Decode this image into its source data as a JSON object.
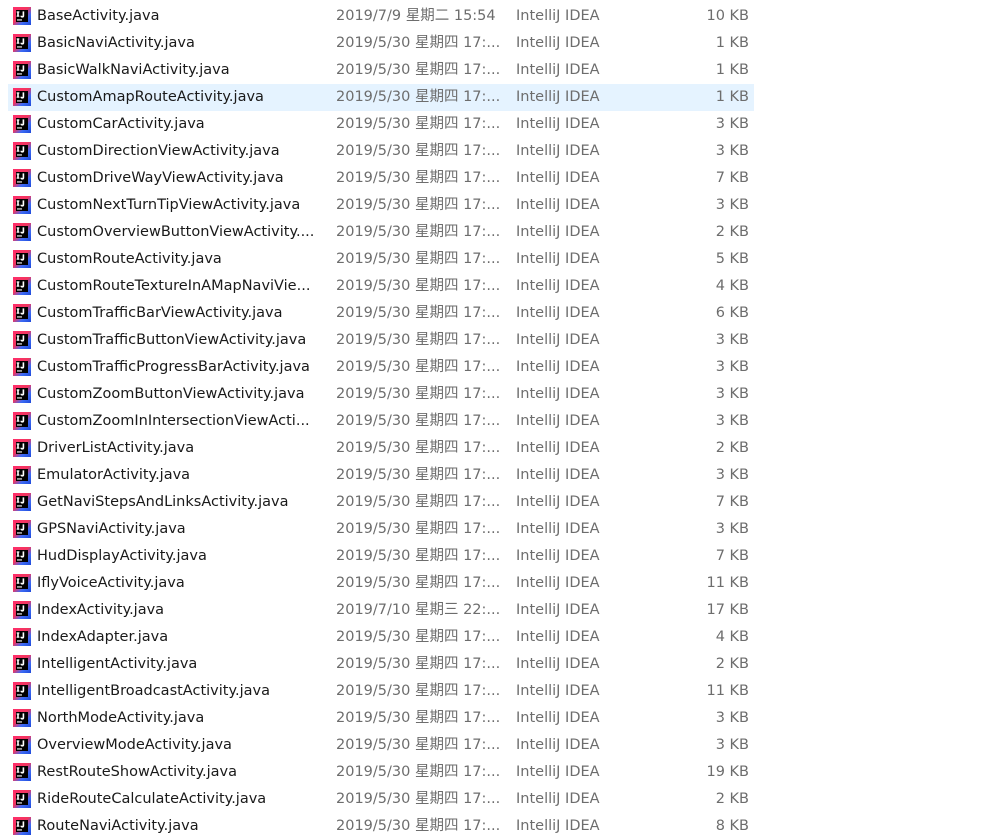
{
  "files": [
    {
      "name": "BaseActivity.java",
      "date": "2019/7/9 星期二 15:54",
      "type": "IntelliJ IDEA",
      "size": "10 KB",
      "icon": "intellij-idea-icon"
    },
    {
      "name": "BasicNaviActivity.java",
      "date": "2019/5/30 星期四 17:...",
      "type": "IntelliJ IDEA",
      "size": "1 KB",
      "icon": "intellij-idea-icon"
    },
    {
      "name": "BasicWalkNaviActivity.java",
      "date": "2019/5/30 星期四 17:...",
      "type": "IntelliJ IDEA",
      "size": "1 KB",
      "icon": "intellij-idea-icon"
    },
    {
      "name": "CustomAmapRouteActivity.java",
      "date": "2019/5/30 星期四 17:...",
      "type": "IntelliJ IDEA",
      "size": "1 KB",
      "icon": "intellij-idea-icon",
      "selected": true
    },
    {
      "name": "CustomCarActivity.java",
      "date": "2019/5/30 星期四 17:...",
      "type": "IntelliJ IDEA",
      "size": "3 KB",
      "icon": "intellij-idea-icon"
    },
    {
      "name": "CustomDirectionViewActivity.java",
      "date": "2019/5/30 星期四 17:...",
      "type": "IntelliJ IDEA",
      "size": "3 KB",
      "icon": "intellij-idea-icon"
    },
    {
      "name": "CustomDriveWayViewActivity.java",
      "date": "2019/5/30 星期四 17:...",
      "type": "IntelliJ IDEA",
      "size": "7 KB",
      "icon": "intellij-idea-icon"
    },
    {
      "name": "CustomNextTurnTipViewActivity.java",
      "date": "2019/5/30 星期四 17:...",
      "type": "IntelliJ IDEA",
      "size": "3 KB",
      "icon": "intellij-idea-icon"
    },
    {
      "name": "CustomOverviewButtonViewActivity....",
      "date": "2019/5/30 星期四 17:...",
      "type": "IntelliJ IDEA",
      "size": "2 KB",
      "icon": "intellij-idea-icon"
    },
    {
      "name": "CustomRouteActivity.java",
      "date": "2019/5/30 星期四 17:...",
      "type": "IntelliJ IDEA",
      "size": "5 KB",
      "icon": "intellij-idea-icon"
    },
    {
      "name": "CustomRouteTextureInAMapNaviVie...",
      "date": "2019/5/30 星期四 17:...",
      "type": "IntelliJ IDEA",
      "size": "4 KB",
      "icon": "intellij-idea-icon"
    },
    {
      "name": "CustomTrafficBarViewActivity.java",
      "date": "2019/5/30 星期四 17:...",
      "type": "IntelliJ IDEA",
      "size": "6 KB",
      "icon": "intellij-idea-icon"
    },
    {
      "name": "CustomTrafficButtonViewActivity.java",
      "date": "2019/5/30 星期四 17:...",
      "type": "IntelliJ IDEA",
      "size": "3 KB",
      "icon": "intellij-idea-icon"
    },
    {
      "name": "CustomTrafficProgressBarActivity.java",
      "date": "2019/5/30 星期四 17:...",
      "type": "IntelliJ IDEA",
      "size": "3 KB",
      "icon": "intellij-idea-icon"
    },
    {
      "name": "CustomZoomButtonViewActivity.java",
      "date": "2019/5/30 星期四 17:...",
      "type": "IntelliJ IDEA",
      "size": "3 KB",
      "icon": "intellij-idea-icon"
    },
    {
      "name": "CustomZoomInIntersectionViewActi...",
      "date": "2019/5/30 星期四 17:...",
      "type": "IntelliJ IDEA",
      "size": "3 KB",
      "icon": "intellij-idea-icon"
    },
    {
      "name": "DriverListActivity.java",
      "date": "2019/5/30 星期四 17:...",
      "type": "IntelliJ IDEA",
      "size": "2 KB",
      "icon": "intellij-idea-icon"
    },
    {
      "name": "EmulatorActivity.java",
      "date": "2019/5/30 星期四 17:...",
      "type": "IntelliJ IDEA",
      "size": "3 KB",
      "icon": "intellij-idea-icon"
    },
    {
      "name": "GetNaviStepsAndLinksActivity.java",
      "date": "2019/5/30 星期四 17:...",
      "type": "IntelliJ IDEA",
      "size": "7 KB",
      "icon": "intellij-idea-icon"
    },
    {
      "name": "GPSNaviActivity.java",
      "date": "2019/5/30 星期四 17:...",
      "type": "IntelliJ IDEA",
      "size": "3 KB",
      "icon": "intellij-idea-icon"
    },
    {
      "name": "HudDisplayActivity.java",
      "date": "2019/5/30 星期四 17:...",
      "type": "IntelliJ IDEA",
      "size": "7 KB",
      "icon": "intellij-idea-icon"
    },
    {
      "name": "IflyVoiceActivity.java",
      "date": "2019/5/30 星期四 17:...",
      "type": "IntelliJ IDEA",
      "size": "11 KB",
      "icon": "intellij-idea-icon"
    },
    {
      "name": "IndexActivity.java",
      "date": "2019/7/10 星期三 22:...",
      "type": "IntelliJ IDEA",
      "size": "17 KB",
      "icon": "intellij-idea-icon"
    },
    {
      "name": "IndexAdapter.java",
      "date": "2019/5/30 星期四 17:...",
      "type": "IntelliJ IDEA",
      "size": "4 KB",
      "icon": "intellij-idea-icon"
    },
    {
      "name": "IntelligentActivity.java",
      "date": "2019/5/30 星期四 17:...",
      "type": "IntelliJ IDEA",
      "size": "2 KB",
      "icon": "intellij-idea-icon"
    },
    {
      "name": "IntelligentBroadcastActivity.java",
      "date": "2019/5/30 星期四 17:...",
      "type": "IntelliJ IDEA",
      "size": "11 KB",
      "icon": "intellij-idea-icon"
    },
    {
      "name": "NorthModeActivity.java",
      "date": "2019/5/30 星期四 17:...",
      "type": "IntelliJ IDEA",
      "size": "3 KB",
      "icon": "intellij-idea-icon"
    },
    {
      "name": "OverviewModeActivity.java",
      "date": "2019/5/30 星期四 17:...",
      "type": "IntelliJ IDEA",
      "size": "3 KB",
      "icon": "intellij-idea-icon"
    },
    {
      "name": "RestRouteShowActivity.java",
      "date": "2019/5/30 星期四 17:...",
      "type": "IntelliJ IDEA",
      "size": "19 KB",
      "icon": "intellij-idea-icon"
    },
    {
      "name": "RideRouteCalculateActivity.java",
      "date": "2019/5/30 星期四 17:...",
      "type": "IntelliJ IDEA",
      "size": "2 KB",
      "icon": "intellij-idea-icon"
    },
    {
      "name": "RouteNaviActivity.java",
      "date": "2019/5/30 星期四 17:...",
      "type": "IntelliJ IDEA",
      "size": "8 KB",
      "icon": "intellij-idea-icon"
    }
  ],
  "colors": {
    "selection_bg": "#e5f3ff",
    "secondary_text": "#6d6d6d",
    "primary_text": "#1a1a1a"
  }
}
